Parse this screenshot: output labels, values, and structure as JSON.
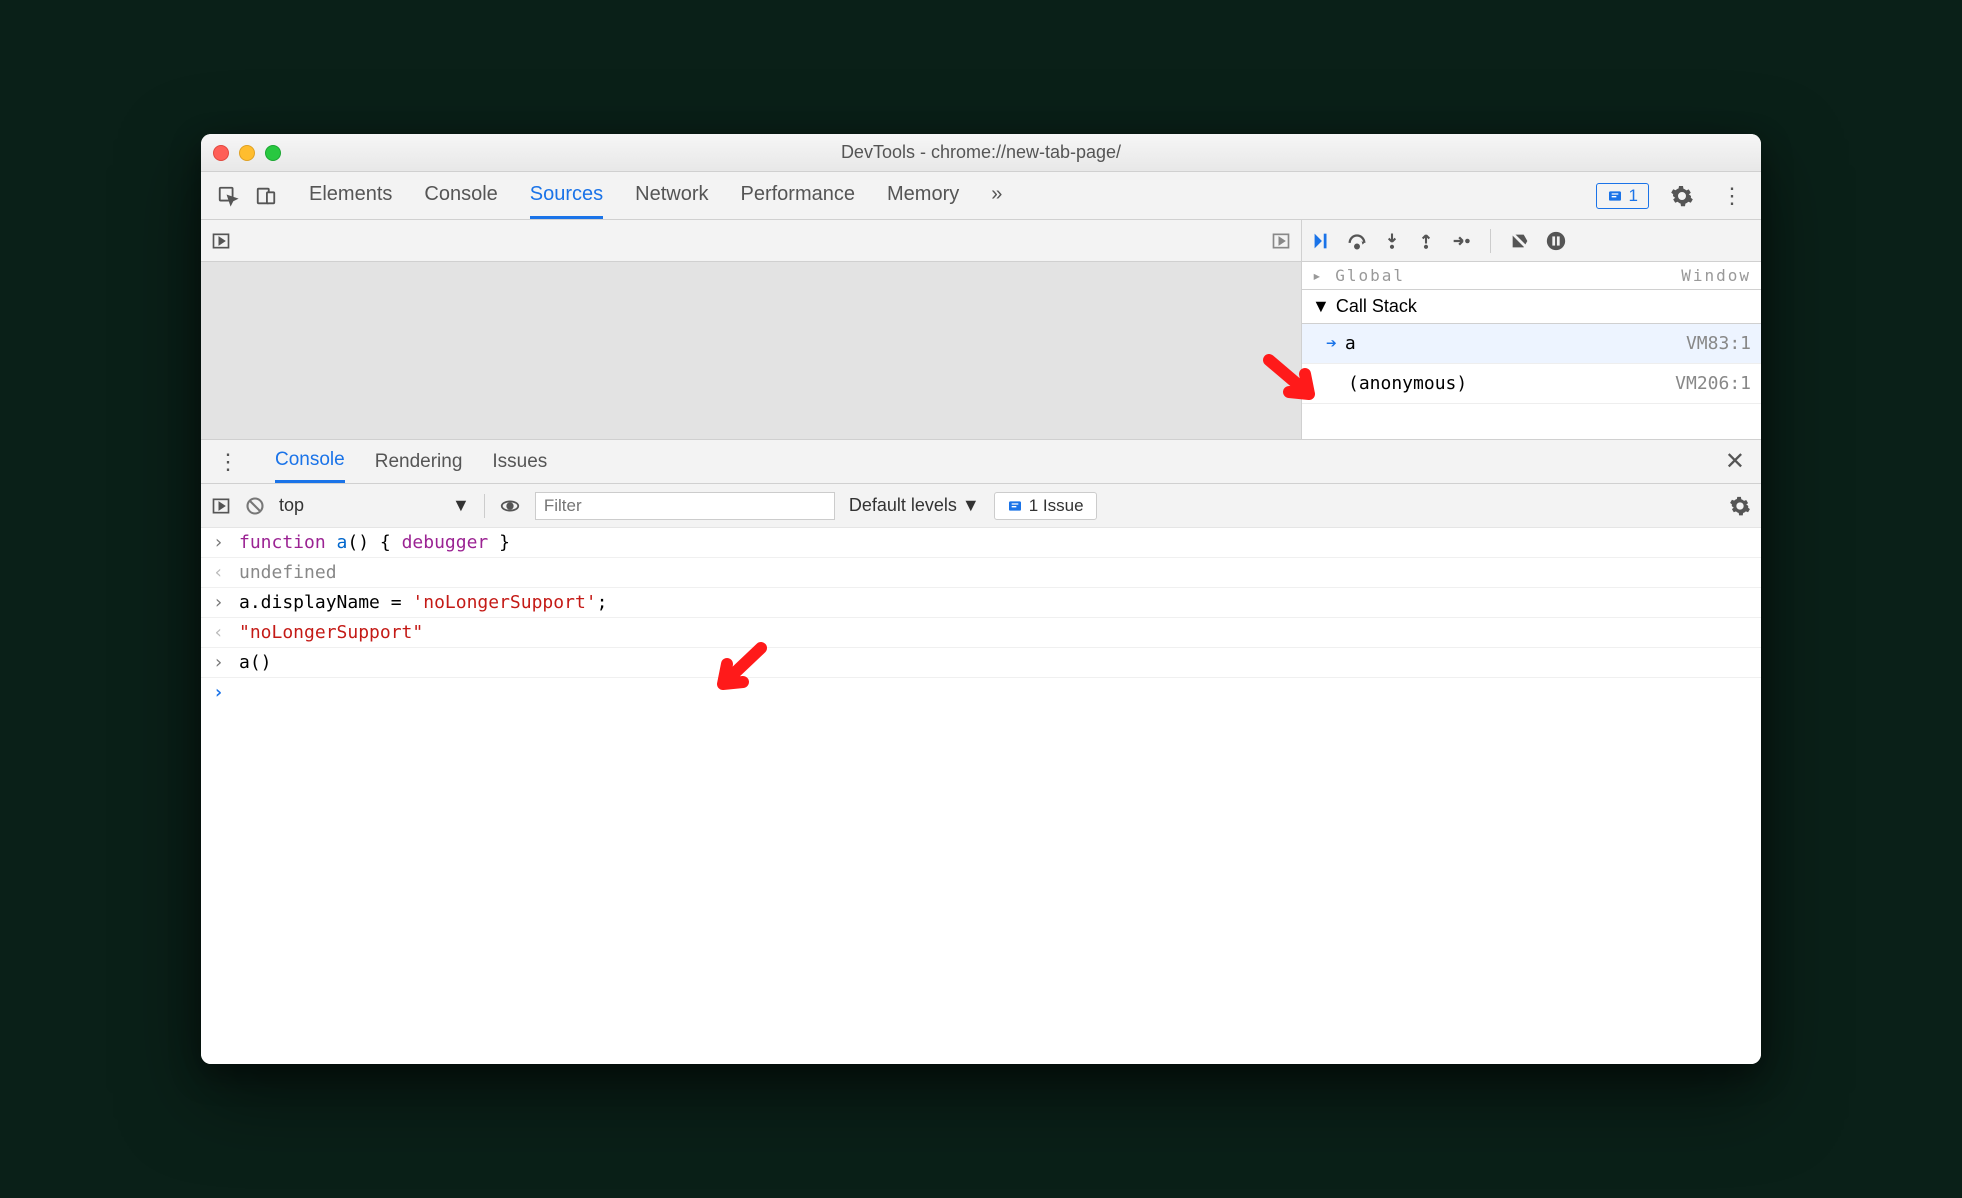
{
  "window": {
    "title": "DevTools - chrome://new-tab-page/"
  },
  "main_tabs": {
    "items": [
      "Elements",
      "Console",
      "Sources",
      "Network",
      "Performance",
      "Memory"
    ],
    "active": "Sources",
    "overflow": "»",
    "issue_count": "1"
  },
  "debugger": {
    "scope_top_left": "▸ Global",
    "scope_top_right": "Window",
    "section": "Call Stack",
    "stack": [
      {
        "name": "a",
        "loc": "VM83:1",
        "active": true
      },
      {
        "name": "(anonymous)",
        "loc": "VM206:1",
        "active": false
      }
    ]
  },
  "drawer": {
    "tabs": [
      "Console",
      "Rendering",
      "Issues"
    ],
    "active": "Console"
  },
  "console_toolbar": {
    "context": "top",
    "filter_placeholder": "Filter",
    "levels": "Default levels ▼",
    "issues": "1 Issue"
  },
  "console": {
    "line1": {
      "kw": "function",
      "fn": "a",
      "rest": "() { ",
      "dbg": "debugger",
      "rest2": " }"
    },
    "line2": "undefined",
    "line3": {
      "pre": "a.displayName = ",
      "str": "'noLongerSupport'",
      "post": ";"
    },
    "line4": "\"noLongerSupport\"",
    "line5": "a()"
  },
  "colors": {
    "accent": "#1a73e8",
    "annotation": "#ff1a1a"
  }
}
